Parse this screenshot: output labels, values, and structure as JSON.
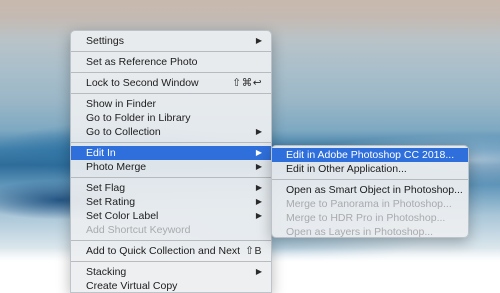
{
  "main_menu": {
    "settings": "Settings",
    "set_reference": "Set as Reference Photo",
    "lock_second_window": "Lock to Second Window",
    "lock_shortcut": "⇧⌘↩",
    "show_in_finder": "Show in Finder",
    "go_to_folder": "Go to Folder in Library",
    "go_to_collection": "Go to Collection",
    "edit_in": "Edit In",
    "photo_merge": "Photo Merge",
    "set_flag": "Set Flag",
    "set_rating": "Set Rating",
    "set_color_label": "Set Color Label",
    "add_shortcut_keyword": "Add Shortcut Keyword",
    "add_quick_collection": "Add to Quick Collection and Next",
    "quick_collection_shortcut": "⇧B",
    "stacking": "Stacking",
    "create_virtual_copy": "Create Virtual Copy"
  },
  "sub_menu": {
    "edit_photoshop": "Edit in Adobe Photoshop CC 2018...",
    "edit_other": "Edit in Other Application...",
    "smart_object": "Open as Smart Object in Photoshop...",
    "merge_panorama": "Merge to Panorama in Photoshop...",
    "merge_hdr": "Merge to HDR Pro in Photoshop...",
    "layers": "Open as Layers in Photoshop..."
  },
  "icons": {
    "submenu_arrow": "triangle-right-icon"
  },
  "colors": {
    "highlight": "#2f6fdb"
  }
}
